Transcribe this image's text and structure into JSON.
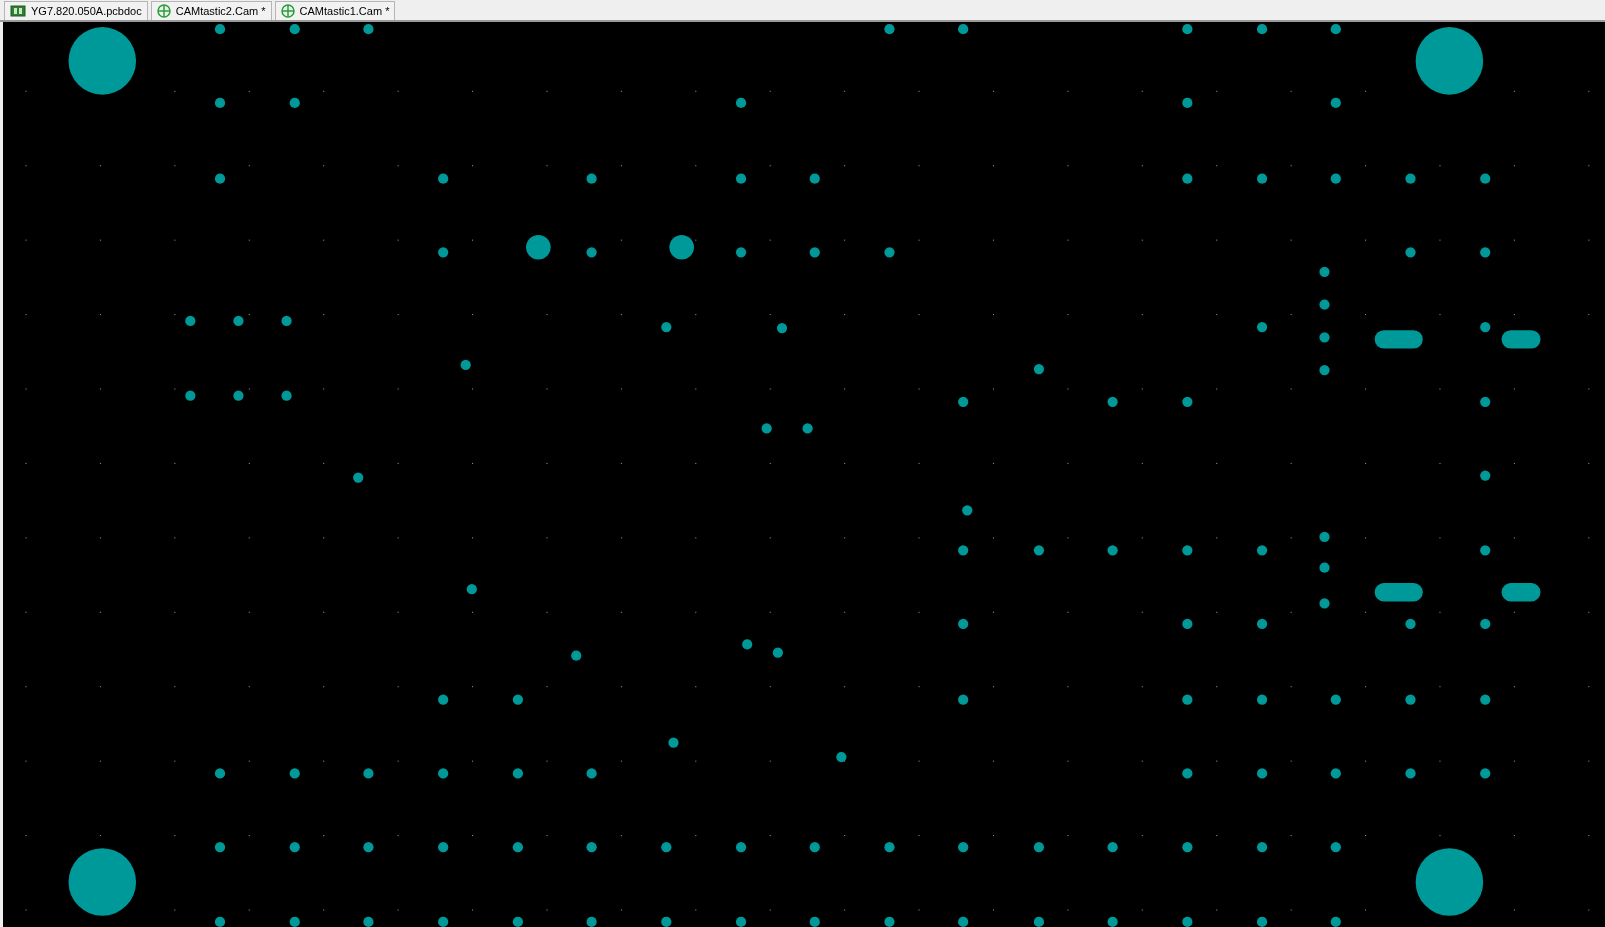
{
  "tabs": [
    {
      "label": "YG7.820.050A.pcbdoc",
      "kind": "pcb"
    },
    {
      "label": "CAMtastic2.Cam *",
      "kind": "cam"
    },
    {
      "label": "CAMtastic1.Cam *",
      "kind": "cam"
    }
  ]
}
